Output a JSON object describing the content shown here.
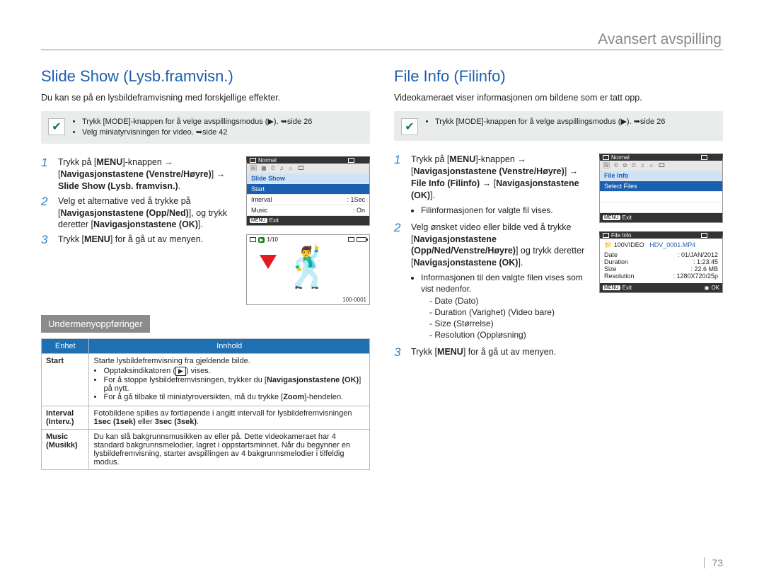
{
  "header": {
    "chapter_title": "Avansert avspilling"
  },
  "page_number": "73",
  "left": {
    "title": "Slide Show (Lysb.framvisn.)",
    "intro": "Du kan se på en lysbildeframvisning med forskjellige effekter.",
    "note_items": [
      "Trykk [MODE]-knappen for å velge avspillingsmodus (▶). ➥side 26",
      "Velg miniatyrvisningen for video. ➥side 42"
    ],
    "steps": [
      {
        "num": "1",
        "body": "Trykk på [MENU]-knappen → [Navigasjonstastene (Venstre/Høyre)] → Slide Show (Lysb. framvisn.)."
      },
      {
        "num": "2",
        "body": "Velg et alternative ved å trykke på [Navigasjonstastene (Opp/Ned)], og trykk deretter [Navigasjonstastene (OK)]."
      },
      {
        "num": "3",
        "body": "Trykk [MENU] for å gå ut av menyen."
      }
    ],
    "submenu_title": "Undermenyoppføringer",
    "subtable": {
      "headers": [
        "Enhet",
        "Innhold"
      ],
      "rows": [
        {
          "label": "Start",
          "content": {
            "lead": "Starte lysbildefremvisning fra gjeldende bilde.",
            "bullets": [
              "Opptaksindikatoren (▶) vises.",
              "For å stoppe lysbildefremvisningen, trykker du [Navigasjonstastene (OK)] på nytt.",
              "For å gå tilbake til miniatyroversikten, må du trykke [Zoom]-hendelen."
            ]
          }
        },
        {
          "label": "Interval (Interv.)",
          "content": {
            "plain": "Fotobildene spilles av fortløpende i angitt intervall for lysbildefremvisningen 1sec (1sek) eller 3sec (3sek)."
          }
        },
        {
          "label": "Music (Musikk)",
          "content": {
            "plain": "Du kan slå bakgrunnsmusikken av eller på. Dette videokameraet har 4 standard bakgrunnsmelodier, lagret i oppstartsminnet. Når du begynner en lysbildefremvisning, starter avspillingen av 4 bakgrunnsmelodier i tilfeldig modus."
          }
        }
      ]
    },
    "lcd1": {
      "top_label": "Normal",
      "header_item": "Slide Show",
      "items": [
        {
          "name": "Start",
          "value": ""
        },
        {
          "name": "Interval",
          "value": ": 1Sec"
        },
        {
          "name": "Music",
          "value": ": On"
        }
      ],
      "exit": "Exit",
      "menu_btn": "MENU"
    },
    "lcd2": {
      "counter": "1/10",
      "filecode": "100-0001"
    }
  },
  "right": {
    "title": "File Info (Filinfo)",
    "intro": "Videokameraet viser informasjonen om bildene som er tatt opp.",
    "note_items": [
      "Trykk [MODE]-knappen for å velge avspillingsmodus (▶). ➥side 26"
    ],
    "steps": [
      {
        "num": "1",
        "body": "Trykk på [MENU]-knappen → [Navigasjonstastene (Venstre/Høyre)] → File Info (Filinfo) → [Navigasjonstastene (OK)].",
        "bullets": [
          "Filinformasjonen for valgte fil vises."
        ]
      },
      {
        "num": "2",
        "body": "Velg ønsket video eller bilde ved å trykke [Navigasjonstastene (Opp/Ned/Venstre/Høyre)] og trykk deretter [Navigasjonstastene (OK)].",
        "bullets": [
          "Informasjonen til den valgte filen vises som vist nedenfor.",
          "- Date (Dato)",
          "- Duration (Varighet) (Video bare)",
          "- Size (Størrelse)",
          "- Resolution (Oppløsning)"
        ]
      },
      {
        "num": "3",
        "body": "Trykk [MENU] for å gå ut av menyen."
      }
    ],
    "lcd1": {
      "top_label": "Normal",
      "header_item": "File Info",
      "items": [
        {
          "name": "Select Files",
          "value": ""
        }
      ],
      "exit": "Exit",
      "menu_btn": "MENU"
    },
    "lcd2": {
      "top_label": "File Info",
      "folder": "100VIDEO",
      "filename": "HDV_0001.MP4",
      "rows": [
        {
          "k": "Date",
          "v": ": 01/JAN/2012"
        },
        {
          "k": "Duration",
          "v": ": 1:23:45"
        },
        {
          "k": "Size",
          "v": ": 22.6 MB"
        },
        {
          "k": "Resolution",
          "v": ": 1280X720/25p"
        }
      ],
      "exit": "Exit",
      "ok": "OK",
      "menu_btn": "MENU"
    }
  }
}
